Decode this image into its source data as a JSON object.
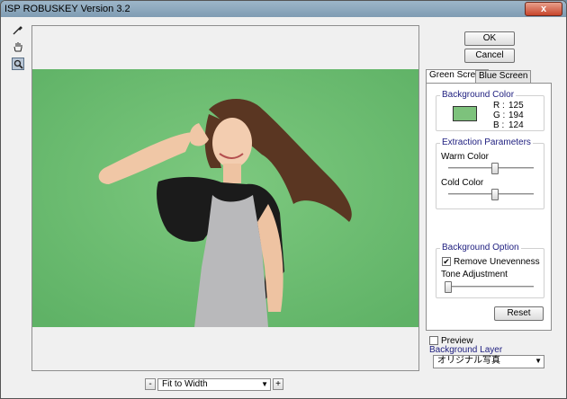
{
  "window": {
    "title": "ISP ROBUSKEY Version 3.2",
    "close": "x"
  },
  "tools": [
    {
      "name": "eyedropper-icon",
      "glyph": "✎"
    },
    {
      "name": "hand-icon",
      "glyph": "✋"
    },
    {
      "name": "magnifier-icon",
      "glyph": "⌕"
    }
  ],
  "zoom": {
    "minus": "-",
    "plus": "+",
    "selected": "Fit to Width"
  },
  "buttons": {
    "ok": "OK",
    "cancel": "Cancel",
    "reset": "Reset"
  },
  "tabs": [
    {
      "label": "Green Screen"
    },
    {
      "label": "Blue Screen"
    }
  ],
  "background_color": {
    "title": "Background Color",
    "swatch": "#7DC27C",
    "r_label": "R :",
    "r_value": "125",
    "g_label": "G :",
    "g_value": "194",
    "b_label": "B :",
    "b_value": "124"
  },
  "extraction": {
    "title": "Extraction Parameters",
    "warm_label": "Warm Color",
    "warm_level": 0.55,
    "cold_label": "Cold Color",
    "cold_level": 0.55
  },
  "background_option": {
    "title": "Background Option",
    "remove_label": "Remove Unevenness",
    "remove_checked": true,
    "tone_label": "Tone Adjustment",
    "tone_level": 0.0
  },
  "preview": {
    "label": "Preview",
    "checked": false
  },
  "background_layer": {
    "label": "Background Layer",
    "selected": "オリジナル写真"
  }
}
